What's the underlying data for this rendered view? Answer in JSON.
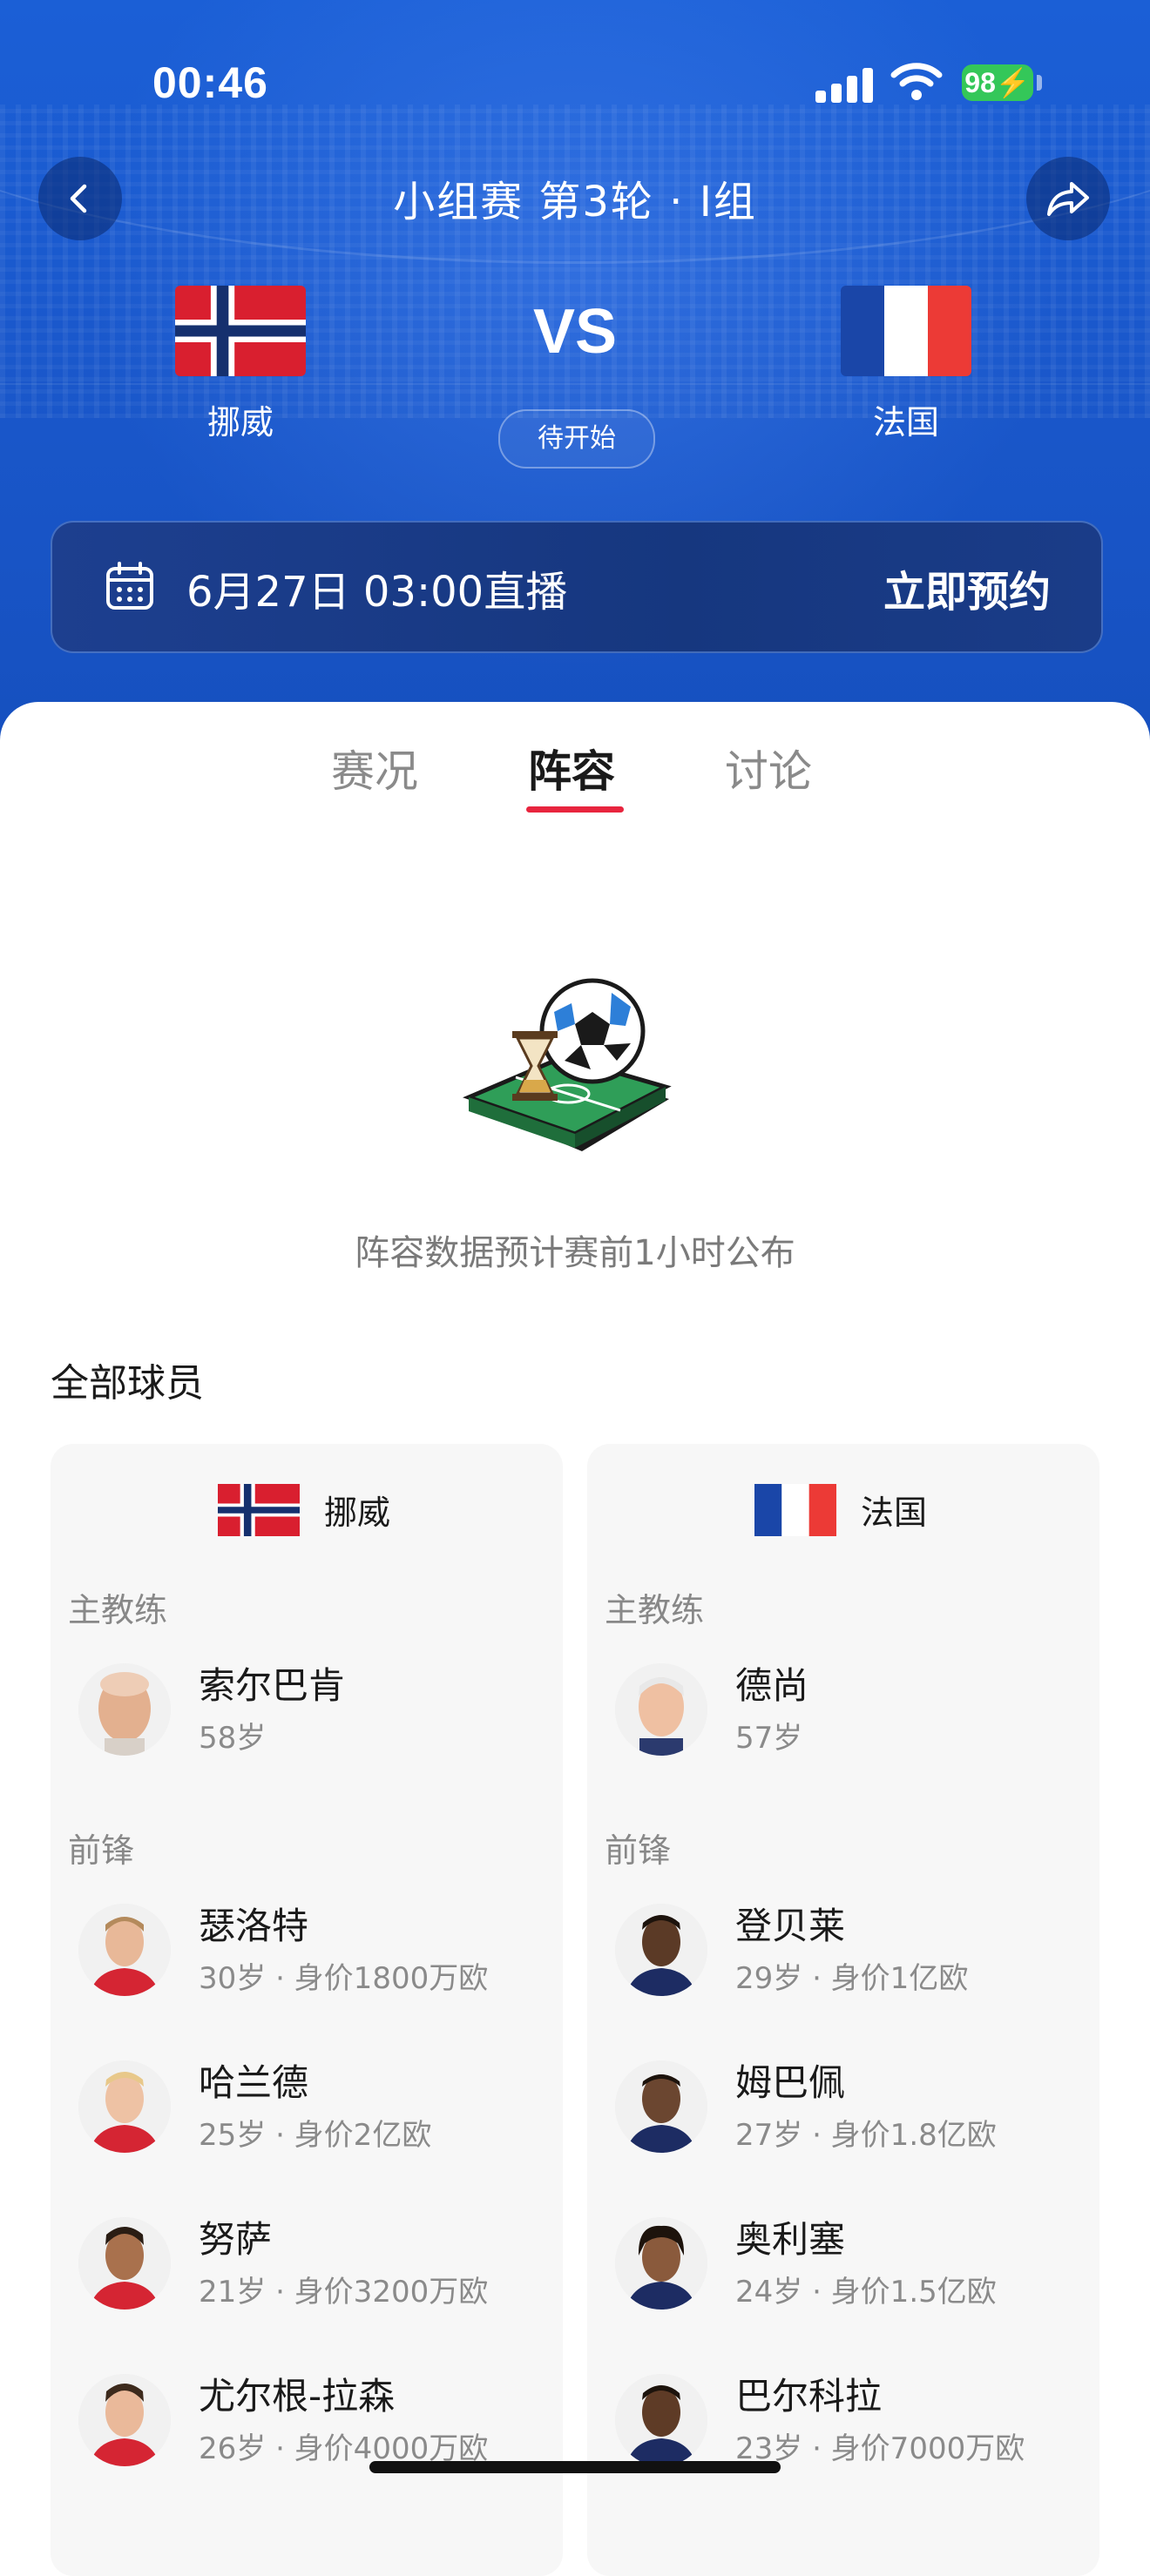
{
  "status_bar": {
    "time": "00:46",
    "battery": "98"
  },
  "header": {
    "title": "小组赛 第3轮 · I组",
    "vs": "VS",
    "status": "待开始",
    "home_team": "挪威",
    "away_team": "法国"
  },
  "booking": {
    "datetime": "6月27日 03:00直播",
    "action": "立即预约"
  },
  "tabs": [
    {
      "label": "赛况"
    },
    {
      "label": "阵容"
    },
    {
      "label": "讨论"
    }
  ],
  "active_tab": "阵容",
  "empty_state": {
    "text": "阵容数据预计赛前1小时公布"
  },
  "section": {
    "title": "全部球员"
  },
  "teams": [
    {
      "name": "挪威",
      "coach_label": "主教练",
      "coach": {
        "name": "索尔巴肯",
        "meta": "58岁"
      },
      "forward_label": "前锋",
      "players": [
        {
          "name": "瑟洛特",
          "meta": "30岁 · 身价1800万欧"
        },
        {
          "name": "哈兰德",
          "meta": "25岁 · 身价2亿欧"
        },
        {
          "name": "努萨",
          "meta": "21岁 · 身价3200万欧"
        },
        {
          "name": "尤尔根-拉森",
          "meta": "26岁 · 身价4000万欧"
        }
      ]
    },
    {
      "name": "法国",
      "coach_label": "主教练",
      "coach": {
        "name": "德尚",
        "meta": "57岁"
      },
      "forward_label": "前锋",
      "players": [
        {
          "name": "登贝莱",
          "meta": "29岁 · 身价1亿欧"
        },
        {
          "name": "姆巴佩",
          "meta": "27岁 · 身价1.8亿欧"
        },
        {
          "name": "奥利塞",
          "meta": "24岁 · 身价1.5亿欧"
        },
        {
          "name": "巴尔科拉",
          "meta": "23岁 · 身价7000万欧"
        }
      ]
    }
  ],
  "colors": {
    "header_blue": "#1a58cc",
    "accent_red": "#e8253e",
    "battery_green": "#34c759"
  }
}
